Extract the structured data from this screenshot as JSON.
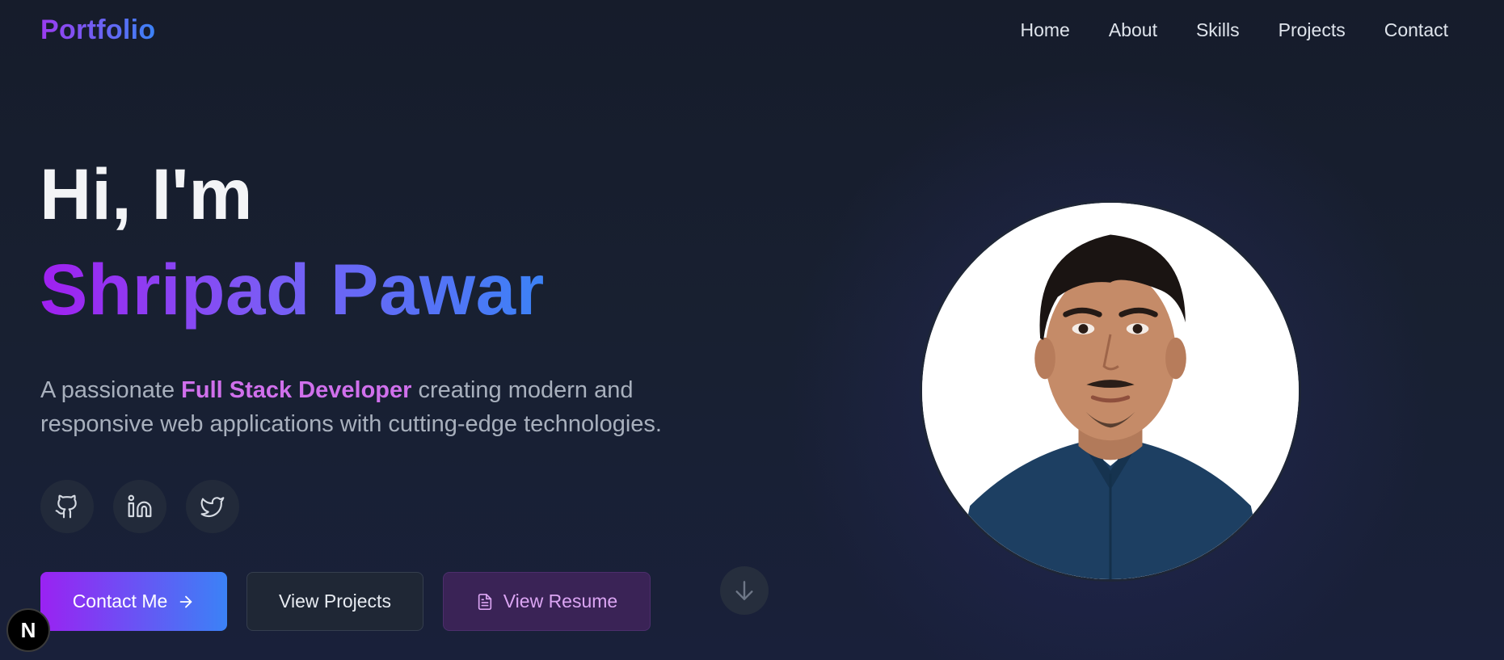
{
  "header": {
    "logo": "Portfolio",
    "nav": [
      "Home",
      "About",
      "Skills",
      "Projects",
      "Contact"
    ]
  },
  "hero": {
    "greeting": "Hi, I'm",
    "name": "Shripad Pawar",
    "tagline_before": "A passionate ",
    "tagline_highlight": "Full Stack Developer",
    "tagline_after": " creating modern and responsive web applications with cutting-edge technologies."
  },
  "socials": [
    {
      "icon": "github-icon"
    },
    {
      "icon": "linkedin-icon"
    },
    {
      "icon": "twitter-icon"
    }
  ],
  "buttons": {
    "contact": "Contact Me",
    "projects": "View Projects",
    "resume": "View Resume"
  },
  "badge": {
    "letter": "N"
  },
  "colors": {
    "background": "#171e2e",
    "accent_purple": "#9a22f2",
    "accent_blue": "#3b82f6",
    "highlight": "#d070ec"
  }
}
